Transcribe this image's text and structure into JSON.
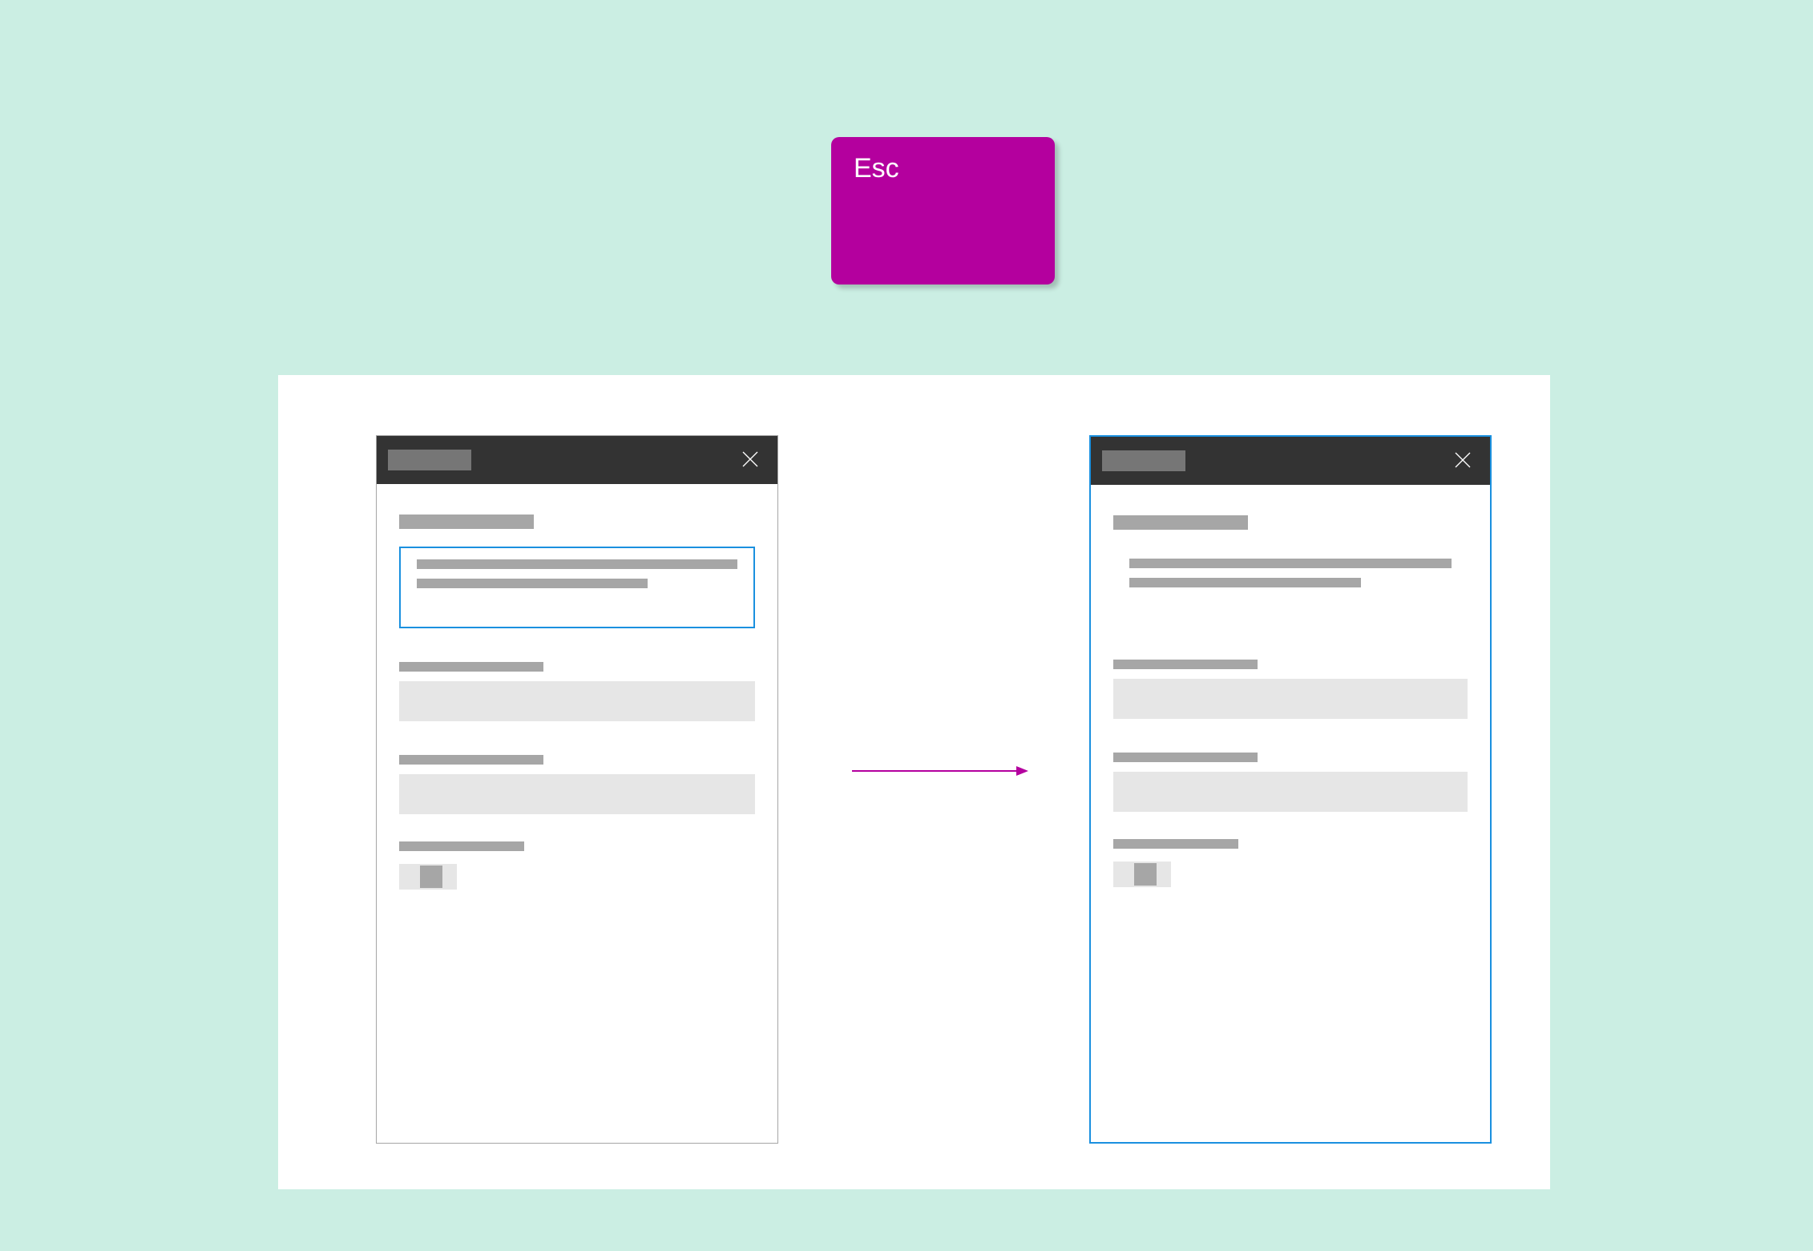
{
  "esc_key": {
    "label": "Esc"
  },
  "colors": {
    "background": "#cbeee3",
    "key": "#b4009e",
    "focus": "#1a90df",
    "titlebar": "#333333",
    "placeholder_dark": "#a6a6a6",
    "placeholder_light": "#e6e6e6",
    "arrow": "#b4009e"
  },
  "panels": {
    "left": {
      "focus_on": "description-box",
      "panel_focused": false
    },
    "right": {
      "focus_on": "panel",
      "panel_focused": true
    }
  }
}
